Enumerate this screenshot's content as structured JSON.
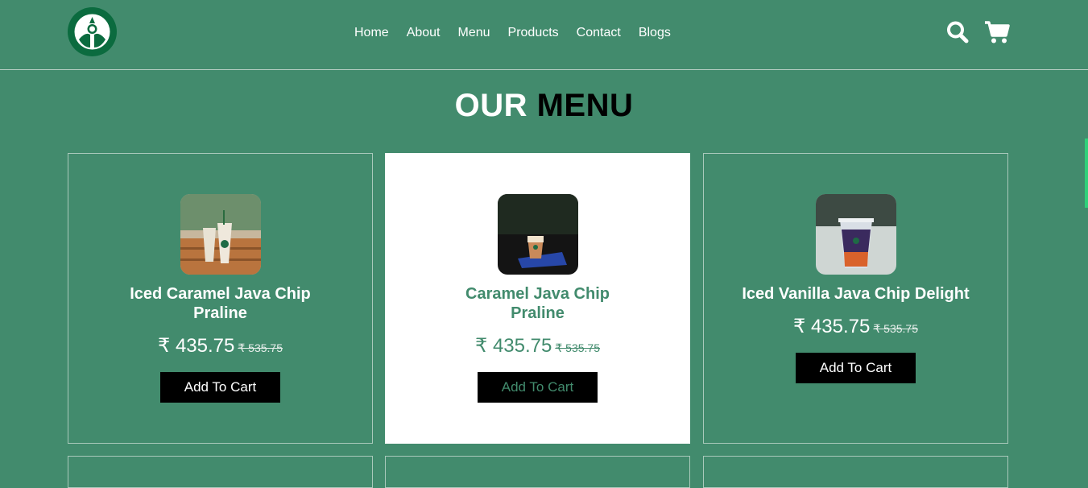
{
  "nav": {
    "items": [
      "Home",
      "About",
      "Menu",
      "Products",
      "Contact",
      "Blogs"
    ]
  },
  "icons": {
    "logo": "starbucks-logo",
    "search": "search-icon",
    "cart": "cart-icon"
  },
  "section": {
    "title_part1": "OUR",
    "title_part2": "MENU"
  },
  "products": [
    {
      "name": "Iced Caramel Java Chip Praline",
      "price": "₹ 435.75",
      "old_price": "₹ 535.75",
      "button": "Add To Cart"
    },
    {
      "name": "Caramel Java Chip Praline",
      "price": "₹ 435.75",
      "old_price": "₹ 535.75",
      "button": "Add To Cart"
    },
    {
      "name": "Iced Vanilla Java Chip Delight",
      "price": "₹ 435.75",
      "old_price": "₹ 535.75",
      "button": "Add To Cart"
    }
  ],
  "colors": {
    "background": "#428b6d",
    "accent_dark": "#000000",
    "card_active": "#ffffff"
  }
}
